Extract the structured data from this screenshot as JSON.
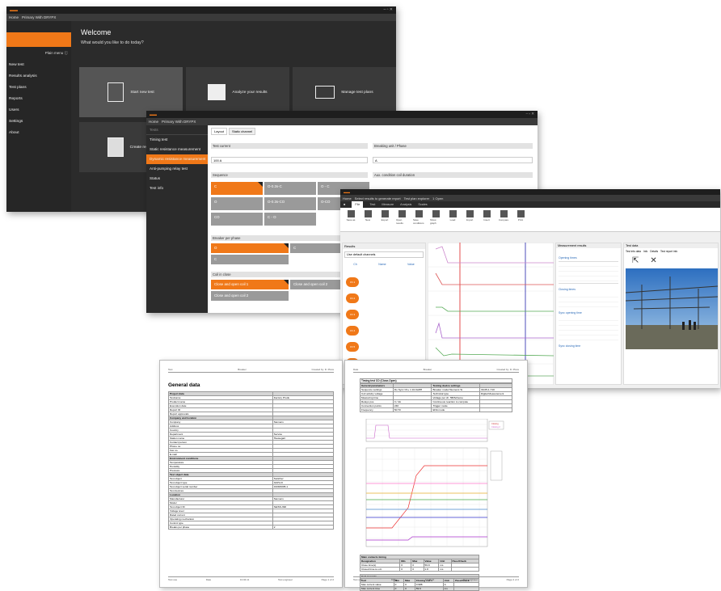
{
  "colors": {
    "accent": "#f07818",
    "dark": "#2b2b2b",
    "panel": "#3a3a3a"
  },
  "w1": {
    "title": "",
    "tabs": [
      "Home",
      "Primary With DRYPX"
    ],
    "plain_menu": "Plain menu ⓘ",
    "nav": [
      "New test",
      "Results analysis",
      "Test plans",
      "Reports",
      "Users",
      "Settings",
      "About"
    ],
    "welcome": "Welcome",
    "question": "What would you like to do today?",
    "tiles": [
      {
        "label": "Start new test",
        "icon": "document-icon"
      },
      {
        "label": "Analyze your results",
        "icon": "bar-chart-icon"
      },
      {
        "label": "Manage test plans",
        "icon": "grid-icon"
      },
      {
        "label": "Create reports",
        "icon": "report-icon"
      }
    ]
  },
  "w2": {
    "tabs": [
      "Home",
      "Primary With DRYPX"
    ],
    "side": [
      "Tests",
      "Timing test",
      "Static resistance measurement",
      "Dynamic resistance measurement",
      "Anti-pumping relay test",
      "Status",
      "Test info"
    ],
    "side_header": "Tests",
    "active_index": 3,
    "subtabs": [
      "Layout",
      "Static channel"
    ],
    "test_current_label": "Test current",
    "test_current_value": "100 A",
    "breaking_label": "Breaking unit / Phase",
    "breaking_value": "A",
    "sequence_label": "Sequence",
    "aux_label": "Aux. condition coil duration",
    "sequence_cells": [
      "C",
      "O-0.3s-C",
      "O - C",
      "O",
      "O-0.3s-CO",
      "O-CO",
      "CO",
      "C - O"
    ],
    "open_label": "Breaker per phase",
    "open_cells": [
      "O",
      "C",
      "C"
    ],
    "coil_label": "Coil in close",
    "coil_cells": [
      "Close and open coil 1",
      "Close and open coil 2",
      "Close and open coil 2"
    ]
  },
  "w3": {
    "tabs": [
      "Home",
      "Select results to generate report",
      "Test plan explorer",
      "1 Open"
    ],
    "rtabs": [
      "File",
      "Test",
      "Measure",
      "Analysis",
      "Scales"
    ],
    "ribbon": [
      "Save as",
      "New",
      "Export",
      "Open results",
      "Save conditions",
      "Show graph",
      "Load",
      "Import",
      "Insert",
      "Compare",
      "Print"
    ],
    "results_title": "Results",
    "results_filter": "Use default channels",
    "cols": [
      "Ch",
      "Name",
      "Value"
    ],
    "channels": [
      "Ch 1",
      "Ch 2",
      "Ch 3",
      "Ch 4",
      "Ch 5",
      "Ch 6"
    ],
    "meas_title": "Measurement results",
    "meas_groups": [
      "Opening times",
      "Closing times",
      "Sync opening time",
      "Sync closing time"
    ],
    "img_title": "Test data",
    "img_tabs": [
      "Test info data",
      "Info",
      "Details",
      "Test report info"
    ]
  },
  "p1": {
    "hdr": [
      "Test",
      "Breaker",
      "Created by: D. Pluss"
    ],
    "title": "General data",
    "rows": [
      [
        "Project data",
        ""
      ],
      [
        "Testname",
        "Factory Produ"
      ],
      [
        "Product name",
        ""
      ],
      [
        "Execution date",
        ""
      ],
      [
        "Report ID",
        ""
      ],
      [
        "Report approvals",
        ""
      ],
      [
        "Company and location",
        ""
      ],
      [
        "Company",
        "Siemens"
      ],
      [
        "Address",
        ""
      ],
      [
        "Country",
        ""
      ],
      [
        "Department",
        "Service"
      ],
      [
        "Station name",
        "Hausegart"
      ],
      [
        "Contact person",
        ""
      ],
      [
        "Phone no.",
        ""
      ],
      [
        "Fax no.",
        ""
      ],
      [
        "E-mail",
        ""
      ],
      [
        "Environment conditions",
        ""
      ],
      [
        "Temperature",
        ""
      ],
      [
        "Humidity",
        ""
      ],
      [
        "Pressure",
        ""
      ],
      [
        "Test object data",
        ""
      ],
      [
        "Test object",
        "Switcher"
      ],
      [
        "Test object type",
        "3AP1-FI"
      ],
      [
        "Test object serial number",
        "4328/2005-1"
      ],
      [
        "Test devices",
        ""
      ],
      [
        "Location",
        ""
      ],
      [
        "Manufacturer",
        "Siemens"
      ],
      [
        "Model",
        ""
      ],
      [
        "Test object ID",
        "SE/SS-390"
      ],
      [
        "Voltage level",
        ""
      ],
      [
        "Rated current",
        ""
      ],
      [
        "Operating mechanism",
        ""
      ],
      [
        "Control type",
        ""
      ],
      [
        "Breaks per phase",
        "2"
      ]
    ],
    "ftr": [
      "Test use",
      "Date",
      "13.04.11",
      "Test engineer",
      "Page 1 of 2"
    ]
  },
  "p2": {
    "hdr": [
      "Date",
      "Breaker",
      "Created by: D. Pluss"
    ],
    "sub": "Timing test  CO (Close-Open)",
    "t1": [
      [
        "General parameters",
        "",
        "Testing device settings",
        ""
      ],
      [
        "Sequence settings",
        "Do Sync Ch+ 1 10-6s/8H",
        "Breaker model  Siemens Si",
        "30-05-1-710"
      ],
      [
        "Coil activity voltage",
        "",
        "Technical type",
        "Digital Measurement"
      ],
      [
        "Measuring time",
        "",
        "Voltage per ch. 5B/Scheme",
        ""
      ],
      [
        "Relays pos.",
        "3 / 4A",
        "Continuous reaction to compute",
        ""
      ],
      [
        "Connection points",
        "240",
        "Trigger mode",
        ""
      ],
      [
        "Frequency",
        "50 Hz",
        "ENA mode",
        ""
      ]
    ],
    "t2h": [
      "Main contacts timing",
      "",
      "",
      "",
      ""
    ],
    "t2": [
      [
        "Designation",
        "Min",
        "Max",
        "Value",
        "Unit",
        "Pass/Check"
      ],
      [
        "Close time(s)",
        "0",
        "0",
        "59.9",
        "ms",
        ""
      ],
      [
        "Closed time-to-o.b.",
        "0",
        "0",
        "1.8",
        "ms",
        ""
      ]
    ],
    "t3h": "Coil currents",
    "t3": [
      [
        "Coil",
        "Min",
        "Max",
        "Closing coil 1",
        "Unit",
        "Pass/Check"
      ],
      [
        "Max current value",
        "0",
        "0",
        "0.988",
        "A",
        ""
      ],
      [
        "Max current time",
        "0",
        "0",
        "59.6",
        "ms",
        ""
      ]
    ],
    "legend": [
      "Closing",
      "Closing 2"
    ],
    "ftr": [
      "Test use",
      "Date",
      "13.04.11",
      "Test engineer",
      "Page 2 of 2"
    ]
  }
}
